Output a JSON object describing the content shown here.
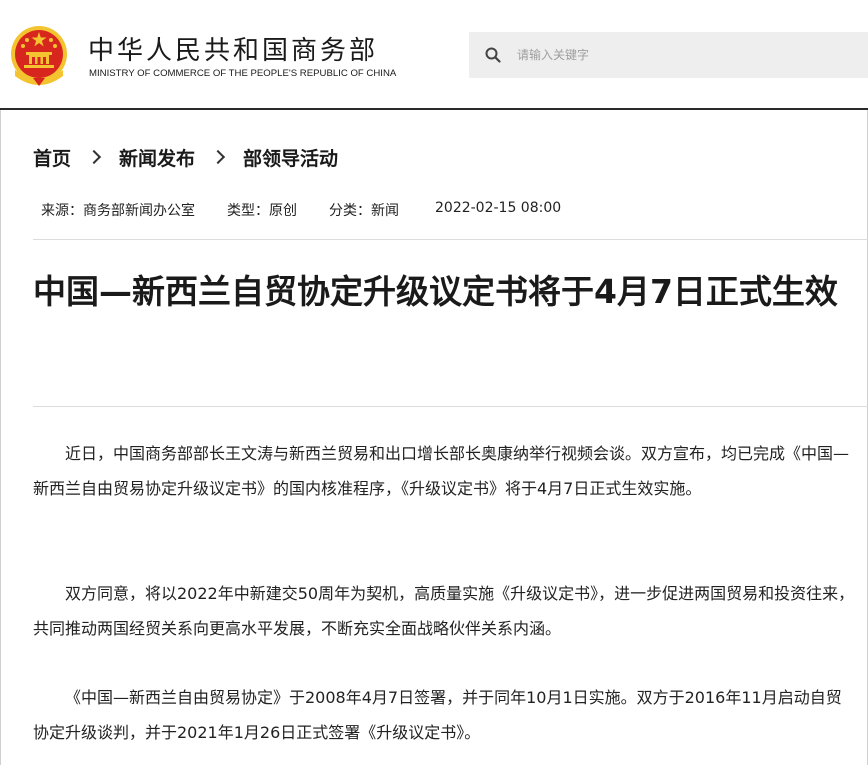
{
  "header": {
    "ministry_cn": "中华人民共和国商务部",
    "ministry_en": "MINISTRY OF COMMERCE OF THE PEOPLE'S REPUBLIC OF CHINA",
    "search_placeholder": "请输入关键字",
    "search_value": ""
  },
  "icons": {
    "emblem": "national-emblem-icon",
    "search": "search-icon"
  },
  "colors": {
    "emblem_red": "#d7261e",
    "emblem_gold": "#f4c430",
    "header_rule": "#2a2a2a",
    "search_bg": "#eeeeee"
  },
  "breadcrumb": [
    "首页",
    "新闻发布",
    "部领导活动"
  ],
  "meta": {
    "source": "来源：商务部新闻办公室",
    "type": "类型：原创",
    "category": "分类：新闻",
    "date": "2022-02-15 08:00"
  },
  "article": {
    "title": "中国—新西兰自贸协定升级议定书将于4月7日正式生效",
    "paragraphs": [
      "近日，中国商务部部长王文涛与新西兰贸易和出口增长部长奥康纳举行视频会谈。双方宣布，均已完成《中国—新西兰自由贸易协定升级议定书》的国内核准程序，《升级议定书》将于4月7日正式生效实施。",
      "双方同意，将以2022年中新建交50周年为契机，高质量实施《升级议定书》，进一步促进两国贸易和投资往来，共同推动两国经贸关系向更高水平发展，不断充实全面战略伙伴关系内涵。",
      "《中国—新西兰自由贸易协定》于2008年4月7日签署，并于同年10月1日实施。双方于2016年11月启动自贸协定升级谈判，并于2021年1月26日正式签署《升级议定书》。"
    ]
  }
}
